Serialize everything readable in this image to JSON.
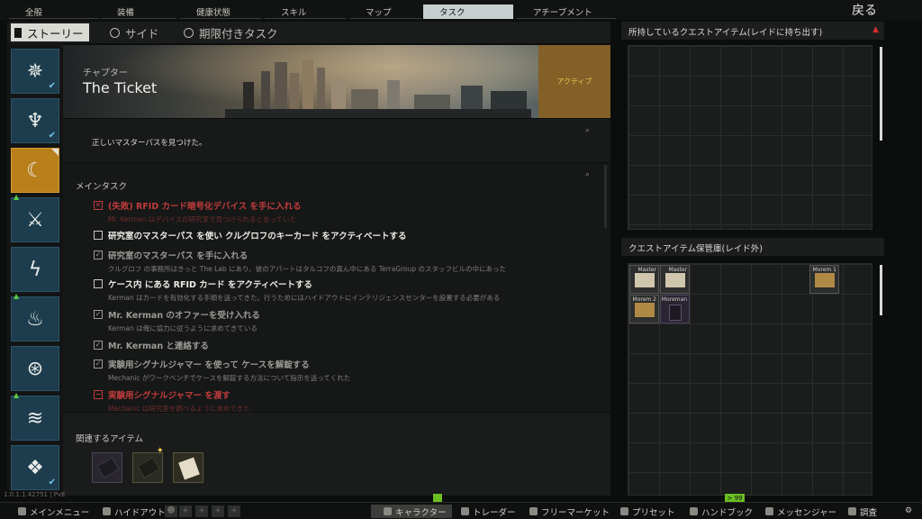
{
  "nav": {
    "tabs": [
      {
        "label": "全般",
        "icon": "overview-icon"
      },
      {
        "label": "装備",
        "icon": "gear-icon"
      },
      {
        "label": "健康状態",
        "icon": "health-icon"
      },
      {
        "label": "スキル",
        "icon": "skills-icon"
      },
      {
        "label": "マップ",
        "icon": "map-pin-icon"
      },
      {
        "label": "タスク",
        "icon": "tasks-icon",
        "active": true
      },
      {
        "label": "アチーブメント",
        "icon": "achievement-icon"
      }
    ],
    "back_label": "戻る"
  },
  "subtabs": [
    {
      "label": "ストーリー",
      "active": true
    },
    {
      "label": "サイド"
    },
    {
      "label": "期限付きタスク"
    }
  ],
  "banner": {
    "chapter_label": "チャプター",
    "chapter_title": "The Ticket",
    "status": "アクティブ"
  },
  "description": "正しいマスターパスを見つけた。",
  "main_tasks": {
    "heading": "メインタスク",
    "items": [
      {
        "state": "failed",
        "title": "(失敗) RFID カード暗号化デバイス を手に入れる",
        "subtitle": "Mr. Kerman はデバイスの研究室で見つけられると言っていた"
      },
      {
        "state": "open",
        "title": "研究室のマスターパス を使い クルグロフのキーカード をアクティベートする",
        "subtitle": ""
      },
      {
        "state": "done",
        "title": "研究室のマスターパス を手に入れる",
        "subtitle": "クルグロフ の事務所はきっと The Lab にあり、彼のアパートはタルコフの真ん中にある TerraGroup のスタッフビルの中にあった"
      },
      {
        "state": "open",
        "title": "ケース内 にある RFID カード をアクティベートする",
        "subtitle": "Kerman はカードを有効化する手順を送ってきた。行うためにはハイドアウトにインテリジェンスセンターを設置する必要がある"
      },
      {
        "state": "done",
        "title": "Mr. Kerman のオファーを受け入れる",
        "subtitle": "Kerman は俺に協力に従うように求めてきている"
      },
      {
        "state": "done",
        "title": "Mr. Kerman と連絡する",
        "subtitle": ""
      },
      {
        "state": "done",
        "title": "実験用シグナルジャマー を使って ケースを解錠する",
        "subtitle": "Mechanic がワークベンチでケースを解錠する方法について指示を送ってくれた"
      },
      {
        "state": "failed",
        "title": "実験用シグナルジャマー を渡す",
        "subtitle": "Mechanic は研究室を調べるように求めてきた"
      }
    ]
  },
  "related": {
    "label": "関連するアイテム"
  },
  "right_panel": {
    "carried_title": "所持しているクエストアイテム(レイドに持ち出す)",
    "stash_title": "クエストアイテム保管庫(レイド外)",
    "stash_items": [
      {
        "name": "Master",
        "kind": "pass"
      },
      {
        "name": "Master",
        "kind": "pass"
      },
      {
        "name": "Morem 1",
        "kind": "tape"
      },
      {
        "name": "Morem 2",
        "kind": "tape"
      },
      {
        "name": "Moreman",
        "kind": "dark"
      }
    ]
  },
  "bottom": {
    "items": [
      {
        "label": "メインメニュー"
      },
      {
        "label": "ハイドアウト"
      },
      {
        "label": "キャラクター",
        "active": true
      },
      {
        "label": "トレーダー"
      },
      {
        "label": "フリーマーケット"
      },
      {
        "label": "プリセット"
      },
      {
        "label": "ハンドブック"
      },
      {
        "label": "メッセンジャー"
      },
      {
        "label": "調査"
      }
    ],
    "version": "1.0.1.1.42751 | PvE",
    "counter": "> 99"
  }
}
